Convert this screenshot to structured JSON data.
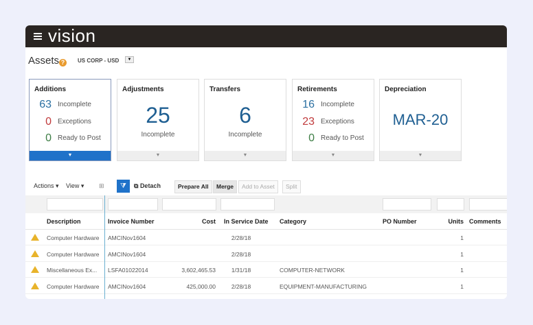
{
  "app": {
    "logo": "vision"
  },
  "page": {
    "title": "Assets",
    "help": "?",
    "ledger": "US CORP - USD"
  },
  "cards": [
    {
      "title": "Additions",
      "rows": [
        {
          "n": "63",
          "l": "Incomplete"
        },
        {
          "n": "0",
          "l": "Exceptions"
        },
        {
          "n": "0",
          "l": "Ready to Post"
        }
      ]
    },
    {
      "title": "Adjustments",
      "big": "25",
      "sub": "Incomplete"
    },
    {
      "title": "Transfers",
      "big": "6",
      "sub": "Incomplete"
    },
    {
      "title": "Retirements",
      "rows": [
        {
          "n": "16",
          "l": "Incomplete"
        },
        {
          "n": "23",
          "l": "Exceptions"
        },
        {
          "n": "0",
          "l": "Ready to Post"
        }
      ]
    },
    {
      "title": "Depreciation",
      "big": "MAR-20"
    }
  ],
  "toolbar": {
    "actions": "Actions",
    "view": "View",
    "detach": "Detach",
    "prepare_all": "Prepare All",
    "merge": "Merge",
    "add_to_asset": "Add to Asset",
    "split": "Split"
  },
  "table": {
    "columns": [
      "Description",
      "Invoice Number",
      "Cost",
      "In Service Date",
      "Category",
      "PO Number",
      "Units",
      "Comments"
    ],
    "rows": [
      [
        "Computer Hardware",
        "AMCINov1604",
        "",
        "2/28/18",
        "",
        "",
        "1",
        ""
      ],
      [
        "Computer Hardware",
        "AMCINov1604",
        "",
        "2/28/18",
        "",
        "",
        "1",
        ""
      ],
      [
        "Miscellaneous Ex...",
        "LSFA01022014",
        "3,602,465.53",
        "1/31/18",
        "COMPUTER-NETWORK",
        "",
        "1",
        ""
      ],
      [
        "Computer Hardware",
        "AMCINov1604",
        "425,000.00",
        "2/28/18",
        "EQUIPMENT-MANUFACTURING",
        "",
        "1",
        ""
      ]
    ]
  }
}
